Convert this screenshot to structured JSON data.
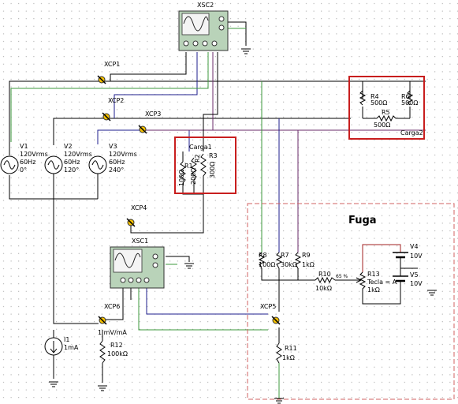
{
  "colors": {
    "grid_dot": "#9a9a9a",
    "wire_black": "#000000",
    "wire_green": "#3c9a3c",
    "wire_blue": "#1e1e8c",
    "wire_purple": "#6a2a6a",
    "wire_red": "#a02020",
    "highlight_box": "#c81e1e",
    "dashed_box": "#d06060",
    "scope_body": "#b9d3b9"
  },
  "scopes": {
    "xsc2": {
      "label": "XSC2"
    },
    "xsc1": {
      "label": "XSC1"
    }
  },
  "probes": {
    "xcp1": "XCP1",
    "xcp2": "XCP2",
    "xcp3": "XCP3",
    "xcp4": "XCP4",
    "xcp5": "XCP5",
    "xcp6": "XCP6"
  },
  "sources": [
    {
      "name": "V1",
      "amp": "120Vrms",
      "freq": "60Hz",
      "phase": "0°"
    },
    {
      "name": "V2",
      "amp": "120Vrms",
      "freq": "60Hz",
      "phase": "120°"
    },
    {
      "name": "V3",
      "amp": "120Vrms",
      "freq": "60Hz",
      "phase": "240°"
    }
  ],
  "carga1": {
    "title": "Carga1",
    "r1": {
      "name": "R1",
      "value": "100Ω"
    },
    "r2": {
      "name": "R2",
      "value": "200Ω"
    },
    "r3": {
      "name": "R3",
      "value": "300Ω"
    }
  },
  "carga2": {
    "title": "Carga2",
    "r4": {
      "name": "R4",
      "value": "500Ω"
    },
    "r5": {
      "name": "R5",
      "value": "500Ω"
    },
    "r6": {
      "name": "R6",
      "value": "500Ω"
    }
  },
  "fuga": {
    "title": "Fuga",
    "r8": {
      "name": "R8",
      "value": "100Ω"
    },
    "r7": {
      "name": "R7",
      "value": "30kΩ"
    },
    "r9": {
      "name": "R9",
      "value": "1kΩ"
    },
    "r10": {
      "name": "R10",
      "value": "10kΩ"
    },
    "r13": {
      "name": "R13",
      "key": "Tecla = A",
      "value": "1kΩ",
      "percent": "65 %"
    },
    "v4": {
      "name": "V4",
      "value": "10V"
    },
    "v5": {
      "name": "V5",
      "value": "10V"
    }
  },
  "r11": {
    "name": "R11",
    "value": "1kΩ"
  },
  "r12": {
    "name": "R12",
    "value": "100kΩ"
  },
  "i1": {
    "name": "I1",
    "value": "1mA"
  },
  "probe_ratio": "1 mV/mA"
}
